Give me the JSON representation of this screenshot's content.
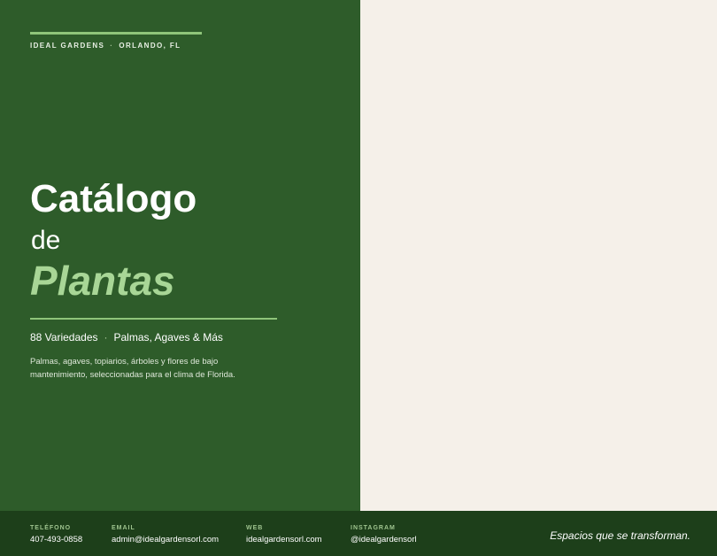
{
  "brand": {
    "name": "IDEAL GARDENS",
    "separator": "·",
    "location": "ORLANDO, FL"
  },
  "title": {
    "main": "Catálogo",
    "connector": "de",
    "accent": "Plantas"
  },
  "stats": {
    "count": "88 Variedades",
    "separator": "·",
    "types": "Palmas, Agaves & Más"
  },
  "description": "Palmas, agaves, topiarios, árboles y flores de bajo mantenimiento, seleccionadas para el clima de Florida.",
  "contacts": {
    "phone": {
      "label": "TELÉFONO",
      "value": "407-493-0858"
    },
    "email": {
      "label": "EMAIL",
      "value": "admin@idealgardensorl.com"
    },
    "web": {
      "label": "WEB",
      "value": "idealgardensorl.com"
    },
    "instagram": {
      "label": "INSTAGRAM",
      "value": "@idealgardensorl"
    }
  },
  "tagline": "Espacios que se transforman.",
  "colors": {
    "primary_green": "#2e5c2a",
    "footer_green": "#1d3f1a",
    "accent_green": "#a8d696",
    "cream": "#f5f0e9"
  }
}
